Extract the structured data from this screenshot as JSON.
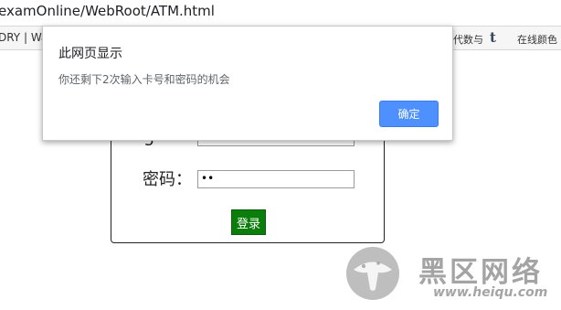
{
  "browser": {
    "url": "examOnline/WebRoot/ATM.html",
    "bookmarks_left": "DRY | Wa",
    "bookmarks_right_1": "代数与",
    "bookmarks_right_2": "在线颜色",
    "tumblr_glyph": "t"
  },
  "form": {
    "card_label_fragment": "5",
    "password_label": "密码：",
    "password_value": "••",
    "login_button": "登录"
  },
  "dialog": {
    "title": "此网页显示",
    "message": "你还剩下2次输入卡号和密码的机会",
    "ok_button": "确定"
  },
  "watermark": {
    "site_name": "黑区网络",
    "site_url": "www.heiqu.com"
  },
  "colors": {
    "accent": "#4d90fe",
    "login_button": "#0a7d0a"
  }
}
